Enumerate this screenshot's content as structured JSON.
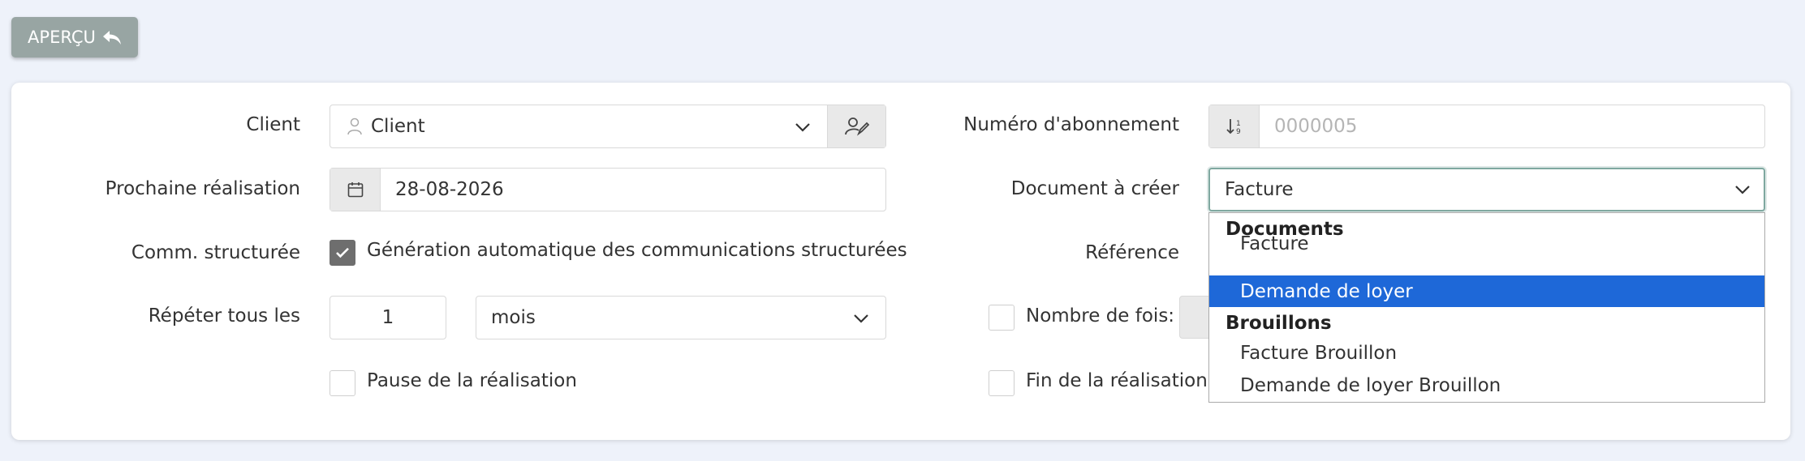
{
  "toolbar": {
    "apercu_label": "APERÇU"
  },
  "form": {
    "client_label": "Client",
    "client_value": "Client",
    "next_label": "Prochaine réalisation",
    "next_value": "28-08-2026",
    "comm_label": "Comm. structurée",
    "comm_text": "Génération automatique des communications structurées",
    "comm_checked": true,
    "repeat_label": "Répéter tous les",
    "repeat_value": "1",
    "repeat_unit": "mois",
    "pause_text": "Pause de la réalisation",
    "sub_number_label": "Numéro d'abonnement",
    "sub_number_placeholder": "0000005",
    "doc_label": "Document à créer",
    "doc_value": "Facture",
    "reference_label": "Référence",
    "times_label": "Nombre de fois:",
    "end_label": "Fin de la réalisation ap"
  },
  "dropdown": {
    "groups": [
      {
        "label": "Documents",
        "options": [
          "Facture",
          "Demande de loyer"
        ]
      },
      {
        "label": "Brouillons",
        "options": [
          "Facture Brouillon",
          "Demande de loyer Brouillon"
        ]
      }
    ],
    "selected": "Demande de loyer"
  },
  "colors": {
    "accent": "#1e68d8",
    "button": "#98a5a3",
    "checkbox": "#6e6e6e"
  }
}
